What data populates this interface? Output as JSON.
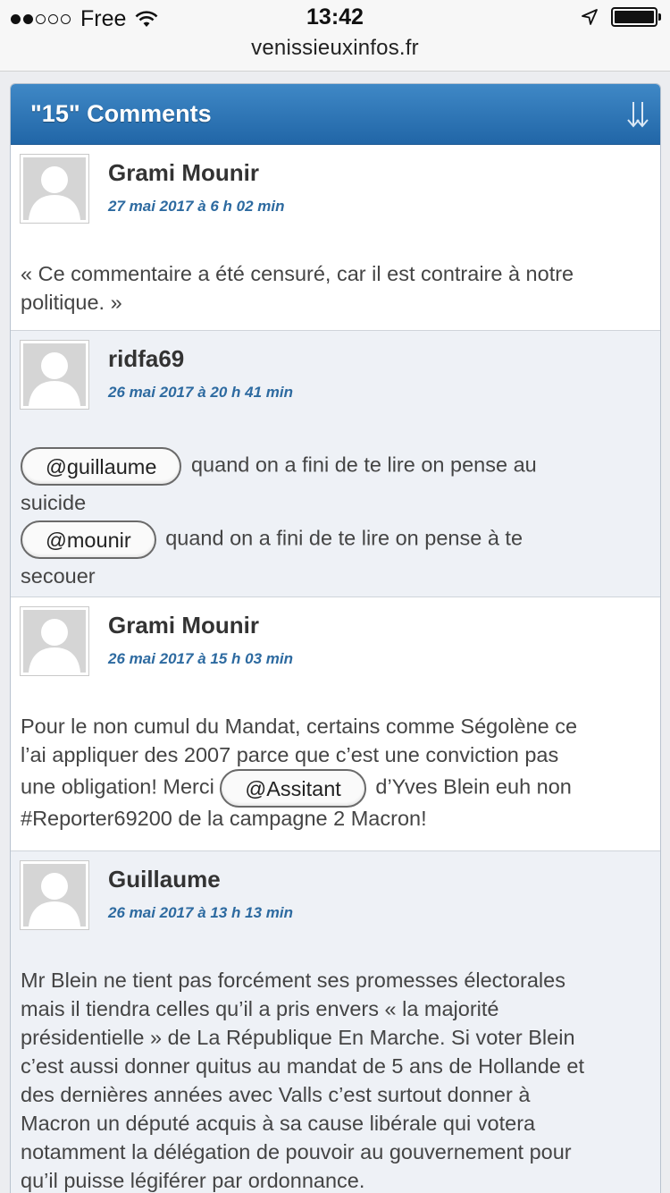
{
  "status_bar": {
    "carrier": "Free",
    "time": "13:42",
    "url": "venissieuxinfos.fr"
  },
  "panel": {
    "title": "\"15\" Comments"
  },
  "comments": [
    {
      "author": "Grami Mounir",
      "date": "27 mai 2017 à 6 h 02 min",
      "text": "« Ce commentaire a été censuré, car il est contraire à notre politique. »"
    },
    {
      "author": "ridfa69",
      "date": "26 mai 2017 à 20 h 41 min",
      "mention1": "@guillaume",
      "text1a": " quand on a fini de te lire on pense au",
      "text1b": "suicide",
      "mention2": "@mounir",
      "text2a": " quand on a fini de te lire on pense à te",
      "text2b": "secouer"
    },
    {
      "author": "Grami Mounir",
      "date": "26 mai 2017 à 15 h 03 min",
      "line1": "Pour le non cumul du Mandat, certains comme Ségolène ce",
      "line2": "l’ai appliquer des 2007 parce que c’est une conviction pas",
      "line3a": "une obligation! Merci ",
      "mention": "@Assitant",
      "line3b": " d’Yves Blein euh non",
      "line4": "#Reporter69200 de la campagne 2 Macron!"
    },
    {
      "author": "Guillaume",
      "date": "26 mai 2017 à 13 h 13 min",
      "lines": [
        "Mr Blein ne tient pas forcément ses promesses électorales",
        "mais il tiendra celles qu’il a pris envers « la majorité",
        "présidentielle » de La République En Marche. Si voter Blein",
        "c’est aussi donner quitus au mandat de 5 ans de Hollande et",
        "des dernières années avec Valls c’est surtout donner à",
        "Macron un député acquis à sa cause libérale qui votera",
        "notamment la délégation de pouvoir au gouvernement pour",
        "qu’il puisse légiférer par ordonnance."
      ]
    }
  ]
}
